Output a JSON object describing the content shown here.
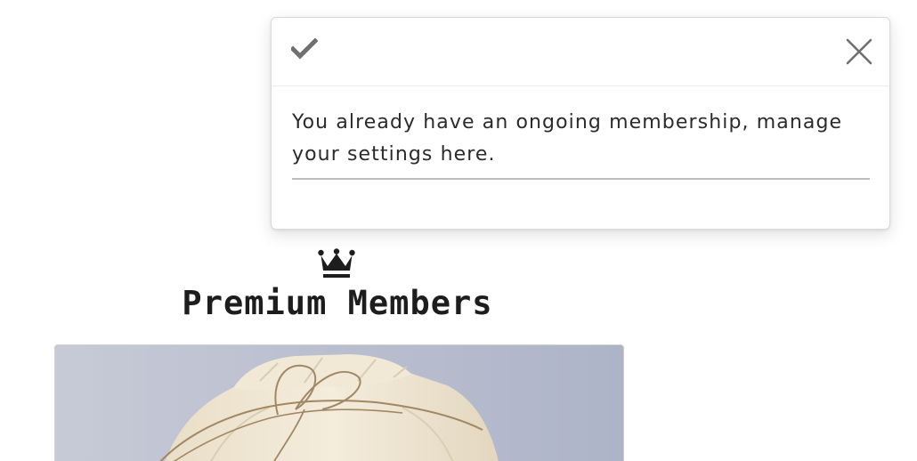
{
  "toast": {
    "status_icon": "check-icon",
    "close_icon": "close-icon",
    "message": "You already have an ongoing membership, manage your settings here."
  },
  "section": {
    "icon": "crown-icon",
    "title": "Premium Members"
  },
  "hero_image": {
    "subject": "paper-bag-tied-with-twine"
  },
  "colors": {
    "text": "#2b2b2b",
    "icon": "#6f6f6f",
    "crown": "#1d1d1d",
    "image_background": "#bcc1d1",
    "bag": "#efe6d3",
    "twine": "#a08865"
  }
}
